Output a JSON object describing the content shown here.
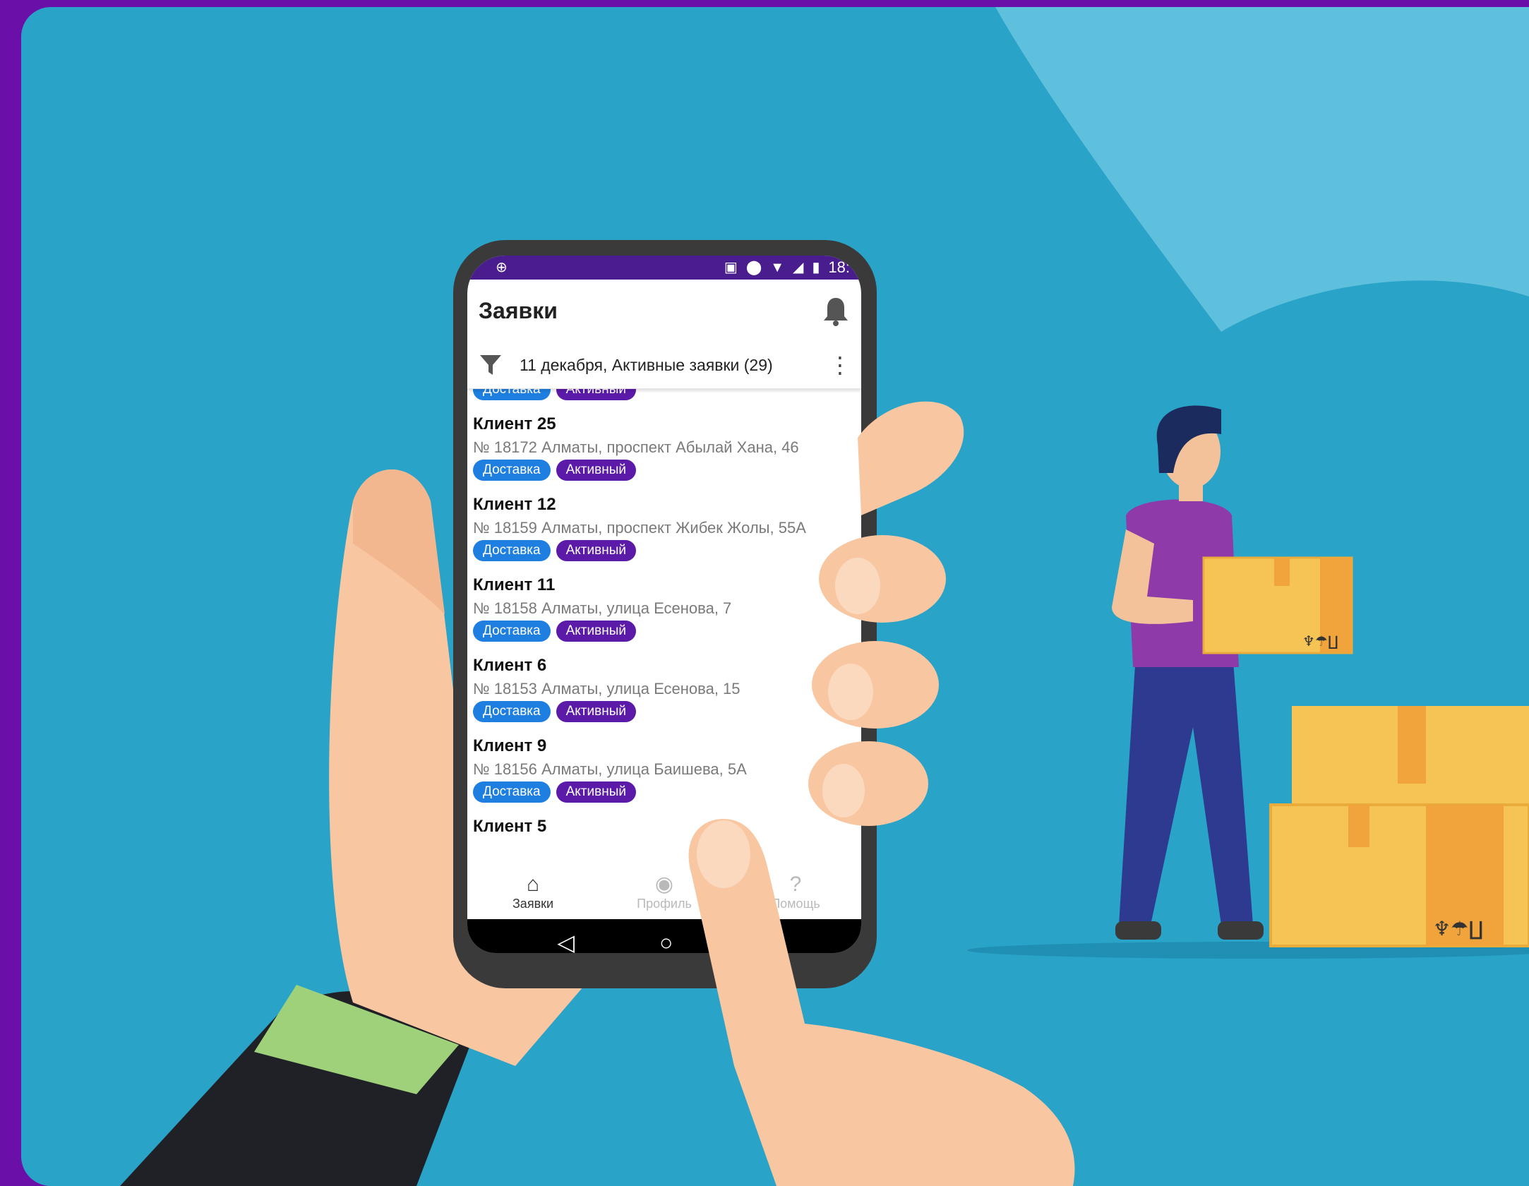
{
  "status_bar": {
    "time": "18:",
    "left_icon": "steering-wheel-icon",
    "right_icons": [
      "cast-icon",
      "location-icon",
      "wifi-icon",
      "signal-icon",
      "battery-icon"
    ]
  },
  "app_bar": {
    "title": "Заявки",
    "action_icon": "bell-icon"
  },
  "filter_bar": {
    "label": "11 декабря, Активные заявки (29)"
  },
  "top_badges": [
    "Доставка",
    "Активный"
  ],
  "orders": [
    {
      "client": "Клиент 25",
      "address": "№ 18172 Алматы, проспект Абылай Хана, 46",
      "type": "Доставка",
      "status": "Активный"
    },
    {
      "client": "Клиент 12",
      "address": "№ 18159 Алматы, проспект Жибек Жолы, 55А",
      "type": "Доставка",
      "status": "Активный"
    },
    {
      "client": "Клиент 11",
      "address": "№ 18158 Алматы, улица Есенова, 7",
      "type": "Доставка",
      "status": "Активный"
    },
    {
      "client": "Клиент 6",
      "address": "№ 18153 Алматы, улица Есенова, 15",
      "type": "Доставка",
      "status": "Активный"
    },
    {
      "client": "Клиент 9",
      "address": "№ 18156 Алматы, улица Баишева, 5А",
      "type": "Доставка",
      "status": "Активный"
    },
    {
      "client": "Клиент 5",
      "address": "",
      "type": "",
      "status": ""
    }
  ],
  "bottom_nav": [
    {
      "label": "Заявки",
      "icon": "home-icon",
      "active": true
    },
    {
      "label": "Профиль",
      "icon": "profile-icon",
      "active": false
    },
    {
      "label": "Помощь",
      "icon": "help-icon",
      "active": false
    }
  ],
  "colors": {
    "frame": "#6a0fa8",
    "background": "#2aa3c8",
    "status_bar": "#4a1d8f",
    "badge_type": "#1f7fe0",
    "badge_status": "#5b1aa8"
  }
}
